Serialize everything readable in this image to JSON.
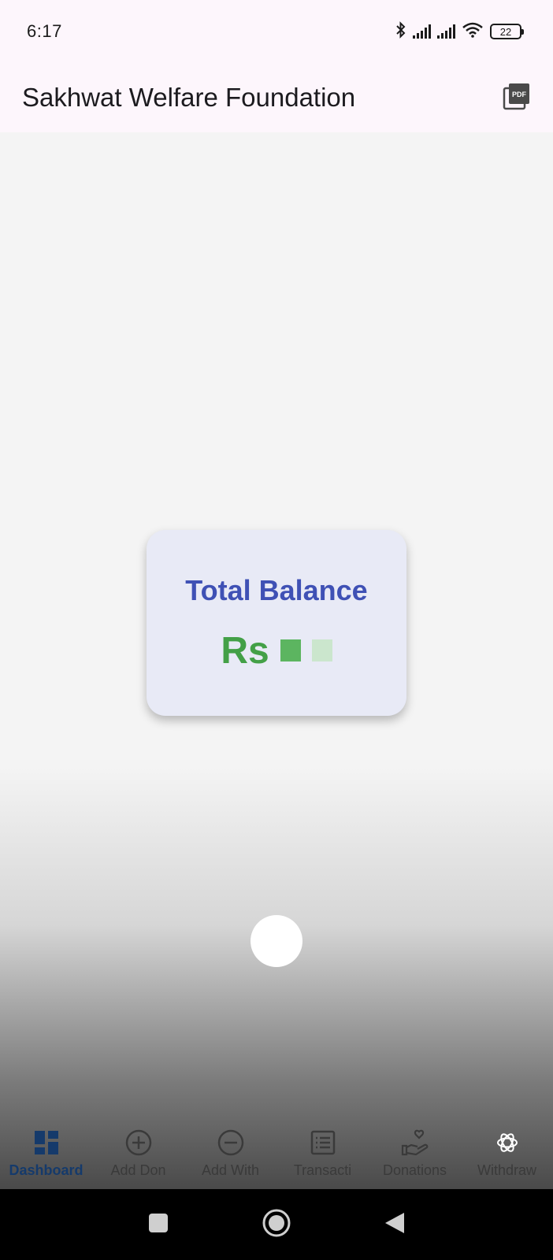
{
  "status_bar": {
    "time": "6:17",
    "battery_level": "22",
    "icons": [
      "bluetooth-icon",
      "signal-icon",
      "signal-icon",
      "wifi-icon",
      "battery-icon"
    ]
  },
  "app_bar": {
    "title": "Sakhwat Welfare Foundation",
    "action_icon": "pdf-icon"
  },
  "balance_card": {
    "label": "Total Balance",
    "currency_prefix": "Rs",
    "value_redacted": true,
    "colors": {
      "label": "#3f51b5",
      "value": "#43a047",
      "card": "#e8eaf6"
    }
  },
  "bottom_nav": {
    "items": [
      {
        "label": "Dashboard",
        "icon": "dashboard-icon",
        "active": true
      },
      {
        "label": "Add Don",
        "icon": "add-circle-icon",
        "active": false
      },
      {
        "label": "Add With",
        "icon": "remove-circle-icon",
        "active": false
      },
      {
        "label": "Transacti",
        "icon": "list-icon",
        "active": false
      },
      {
        "label": "Donations",
        "icon": "donation-hand-icon",
        "active": false
      },
      {
        "label": "Withdraw",
        "icon": "openai-icon",
        "active": false
      }
    ]
  },
  "system_nav": {
    "icons": [
      "square-icon",
      "circle-icon",
      "back-triangle-icon"
    ]
  }
}
